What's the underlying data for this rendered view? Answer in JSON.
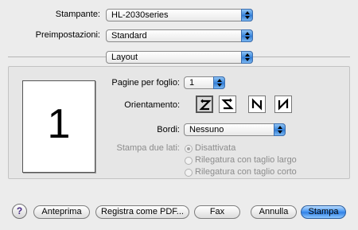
{
  "printer": {
    "label": "Stampante:",
    "value": "HL-2030series"
  },
  "presets": {
    "label": "Preimpostazioni:",
    "value": "Standard"
  },
  "panel": {
    "value": "Layout"
  },
  "preview": {
    "page_number": "1"
  },
  "pages_per_sheet": {
    "label": "Pagine per foglio:",
    "value": "1"
  },
  "orientation": {
    "label": "Orientamento:",
    "options": [
      "Z",
      "S",
      "N-reverse",
      "N"
    ],
    "selected": "Z"
  },
  "borders": {
    "label": "Bordi:",
    "value": "Nessuno"
  },
  "two_sided": {
    "label": "Stampa due lati:",
    "options": [
      "Disattivata",
      "Rilegatura con taglio largo",
      "Rilegatura con taglio corto"
    ],
    "selected": "Disattivata"
  },
  "buttons": {
    "help": "?",
    "preview": "Anteprima",
    "save_pdf": "Registra come PDF...",
    "fax": "Fax",
    "cancel": "Annulla",
    "print": "Stampa"
  }
}
